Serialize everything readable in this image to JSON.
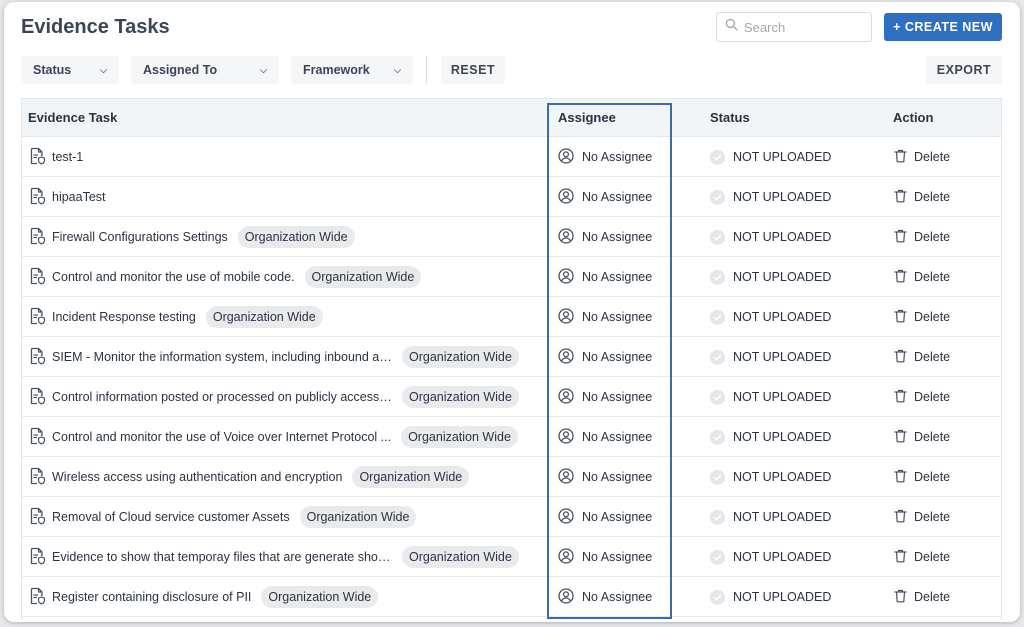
{
  "page": {
    "title": "Evidence Tasks"
  },
  "search": {
    "placeholder": "Search"
  },
  "toolbar": {
    "create_label": "+ CREATE NEW",
    "reset_label": "RESET",
    "export_label": "EXPORT"
  },
  "filters": [
    {
      "label": "Status"
    },
    {
      "label": "Assigned To"
    },
    {
      "label": "Framework"
    }
  ],
  "table": {
    "headers": {
      "task": "Evidence Task",
      "assignee": "Assignee",
      "status": "Status",
      "action": "Action"
    },
    "rows": [
      {
        "task": "test-1",
        "badge": "",
        "assignee": "No Assignee",
        "status": "NOT UPLOADED",
        "action": "Delete"
      },
      {
        "task": "hipaaTest",
        "badge": "",
        "assignee": "No Assignee",
        "status": "NOT UPLOADED",
        "action": "Delete"
      },
      {
        "task": "Firewall Configurations Settings",
        "badge": "Organization Wide",
        "assignee": "No Assignee",
        "status": "NOT UPLOADED",
        "action": "Delete"
      },
      {
        "task": "Control and monitor the use of mobile code.",
        "badge": "Organization Wide",
        "assignee": "No Assignee",
        "status": "NOT UPLOADED",
        "action": "Delete"
      },
      {
        "task": "Incident Response testing",
        "badge": "Organization Wide",
        "assignee": "No Assignee",
        "status": "NOT UPLOADED",
        "action": "Delete"
      },
      {
        "task": "SIEM - Monitor the information system, including inbound and...",
        "badge": "Organization Wide",
        "assignee": "No Assignee",
        "status": "NOT UPLOADED",
        "action": "Delete"
      },
      {
        "task": "Control information posted or processed on publicly accessib...",
        "badge": "Organization Wide",
        "assignee": "No Assignee",
        "status": "NOT UPLOADED",
        "action": "Delete"
      },
      {
        "task": "Control and monitor the use of Voice over Internet Protocol ...",
        "badge": "Organization Wide",
        "assignee": "No Assignee",
        "status": "NOT UPLOADED",
        "action": "Delete"
      },
      {
        "task": "Wireless access using authentication and encryption",
        "badge": "Organization Wide",
        "assignee": "No Assignee",
        "status": "NOT UPLOADED",
        "action": "Delete"
      },
      {
        "task": "Removal of Cloud service customer Assets",
        "badge": "Organization Wide",
        "assignee": "No Assignee",
        "status": "NOT UPLOADED",
        "action": "Delete"
      },
      {
        "task": "Evidence to show that temporay files that are generate shoul...",
        "badge": "Organization Wide",
        "assignee": "No Assignee",
        "status": "NOT UPLOADED",
        "action": "Delete"
      },
      {
        "task": "Register containing disclosure of PII",
        "badge": "Organization Wide",
        "assignee": "No Assignee",
        "status": "NOT UPLOADED",
        "action": "Delete"
      }
    ]
  },
  "icons": {
    "task": "document-shield-icon",
    "assignee": "user-circle-icon",
    "status": "check-circle-icon",
    "action": "trash-icon",
    "search": "search-icon",
    "filter": "chevron-down-icon"
  },
  "colors": {
    "primary": "#2f6fc1",
    "highlight_border": "#3e6aa8",
    "badge_bg": "#e9eaec",
    "header_bg": "#f2f5f8"
  }
}
